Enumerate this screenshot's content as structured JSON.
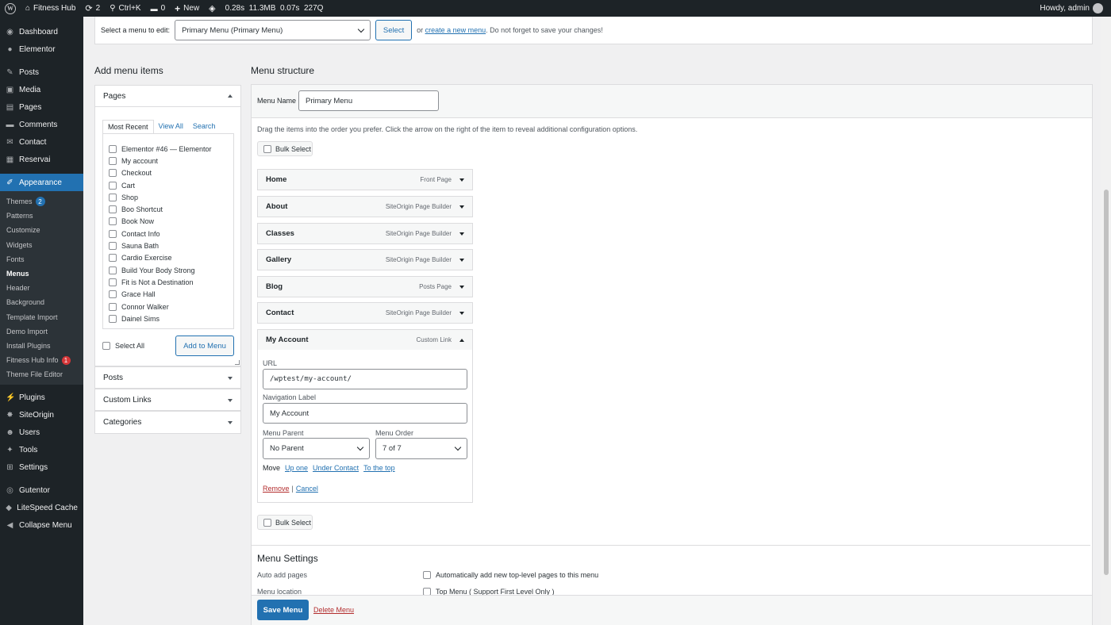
{
  "adminbar": {
    "site_name": "Fitness Hub",
    "updates_count": "2",
    "search_shortcut": "Ctrl+K",
    "comments_count": "0",
    "new_label": "New",
    "perf_stats": "0.28s  11.3MB  0.07s  227Q",
    "greeting": "Howdy, admin"
  },
  "sidebar": {
    "items_top": [
      "Dashboard",
      "Elementor"
    ],
    "items_mid": [
      "Posts",
      "Media",
      "Pages",
      "Comments",
      "Contact",
      "Reservai"
    ],
    "current": "Appearance",
    "submenu": [
      {
        "label": "Themes",
        "badge": "2"
      },
      {
        "label": "Patterns"
      },
      {
        "label": "Customize"
      },
      {
        "label": "Widgets"
      },
      {
        "label": "Fonts"
      },
      {
        "label": "Menus"
      },
      {
        "label": "Header"
      },
      {
        "label": "Background"
      },
      {
        "label": "Template Import"
      },
      {
        "label": "Demo Import"
      },
      {
        "label": "Install Plugins"
      },
      {
        "label": "Fitness Hub Info",
        "badge": "1"
      },
      {
        "label": "Theme File Editor"
      }
    ],
    "items_bottom": [
      "Plugins",
      "SiteOrigin",
      "Users",
      "Tools",
      "Settings"
    ],
    "items_extra": [
      "Gutentor",
      "LiteSpeed Cache",
      "Collapse Menu"
    ]
  },
  "menu_select": {
    "label": "Select a menu to edit:",
    "selected": "Primary Menu (Primary Menu)",
    "button": "Select",
    "or_text": "or",
    "create_link": "create a new menu",
    "suffix": ". Do not forget to save your changes!"
  },
  "add_items": {
    "heading": "Add menu items",
    "pages_title": "Pages",
    "tabs": [
      "Most Recent",
      "View All",
      "Search"
    ],
    "pages": [
      "Elementor #46 — Elementor",
      "My account",
      "Checkout",
      "Cart",
      "Shop",
      "Boo Shortcut",
      "Book Now",
      "Contact Info",
      "Sauna Bath",
      "Cardio Exercise",
      "Build Your Body Strong",
      "Fit is Not a Destination",
      "Grace Hall",
      "Connor Walker",
      "Dainel Sims"
    ],
    "select_all": "Select All",
    "add_button": "Add to Menu",
    "other_sections": [
      "Posts",
      "Custom Links",
      "Categories"
    ]
  },
  "structure": {
    "heading": "Menu structure",
    "menu_name_label": "Menu Name",
    "menu_name_value": "Primary Menu",
    "instructions": "Drag the items into the order you prefer. Click the arrow on the right of the item to reveal additional configuration options.",
    "bulk_select": "Bulk Select",
    "items": [
      {
        "title": "Home",
        "type": "Front Page"
      },
      {
        "title": "About",
        "type": "SiteOrigin Page Builder"
      },
      {
        "title": "Classes",
        "type": "SiteOrigin Page Builder"
      },
      {
        "title": "Gallery",
        "type": "SiteOrigin Page Builder"
      },
      {
        "title": "Blog",
        "type": "Posts Page"
      },
      {
        "title": "Contact",
        "type": "SiteOrigin Page Builder"
      },
      {
        "title": "My Account",
        "type": "Custom Link"
      }
    ],
    "expanded": {
      "url_label": "URL",
      "url_value": "/wptest/my-account/",
      "nav_label": "Navigation Label",
      "nav_value": "My Account",
      "parent_label": "Menu Parent",
      "parent_value": "No Parent",
      "order_label": "Menu Order",
      "order_value": "7 of 7",
      "move_label": "Move",
      "move_links": [
        "Up one",
        "Under Contact",
        "To the top"
      ],
      "remove": "Remove",
      "separator": "|",
      "cancel": "Cancel"
    }
  },
  "settings": {
    "heading": "Menu Settings",
    "auto_add_label": "Auto add pages",
    "auto_add_option": "Automatically add new top-level pages to this menu",
    "location_label": "Menu location",
    "location_option": "Top Menu ( Support First Level Only )"
  },
  "footer": {
    "save": "Save Menu",
    "delete": "Delete Menu"
  }
}
